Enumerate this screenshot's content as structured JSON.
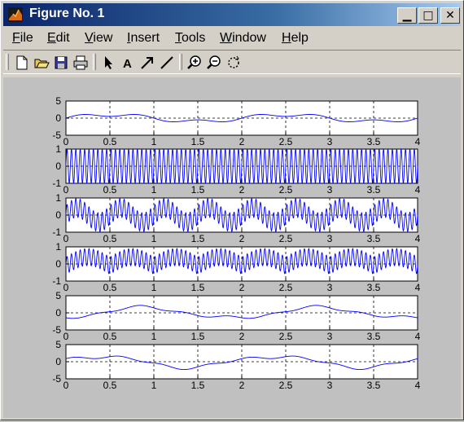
{
  "window": {
    "title": "Figure No. 1"
  },
  "menu": [
    {
      "key": "F",
      "rest": "ile"
    },
    {
      "key": "E",
      "rest": "dit"
    },
    {
      "key": "V",
      "rest": "iew"
    },
    {
      "key": "I",
      "rest": "nsert"
    },
    {
      "key": "T",
      "rest": "ools"
    },
    {
      "key": "W",
      "rest": "indow"
    },
    {
      "key": "H",
      "rest": "elp"
    }
  ],
  "toolbar_icons": [
    "new-file-icon",
    "open-folder-icon",
    "save-icon",
    "print-icon",
    "select-arrow-icon",
    "insert-text-icon",
    "insert-arrow-icon",
    "insert-line-icon",
    "zoom-in-icon",
    "zoom-out-icon",
    "rotate-icon"
  ],
  "colors": {
    "line": "#0000ff",
    "axes_bg": "#ffffff",
    "figure_bg": "#c0c0c0"
  },
  "chart_data": [
    {
      "type": "line",
      "xlim": [
        0,
        4
      ],
      "ylim": [
        -5,
        5
      ],
      "xticks": [
        "0",
        "0.5",
        "1",
        "1.5",
        "2",
        "2.5",
        "3",
        "3.5",
        "4"
      ],
      "yticks": [
        "5",
        "0",
        "-5"
      ],
      "grid": true,
      "series": [
        {
          "signal": "slow wave",
          "x_range": [
            0,
            4
          ]
        }
      ]
    },
    {
      "type": "line",
      "xlim": [
        0,
        4
      ],
      "ylim": [
        -1,
        1
      ],
      "xticks": [
        "0",
        "0.5",
        "1",
        "1.5",
        "2",
        "2.5",
        "3",
        "3.5",
        "4"
      ],
      "yticks": [
        "1",
        "0",
        "-1"
      ],
      "grid": true,
      "series": [
        {
          "signal": "fast oscillation",
          "x_range": [
            0,
            4
          ]
        }
      ]
    },
    {
      "type": "line",
      "xlim": [
        0,
        4
      ],
      "ylim": [
        -1,
        1
      ],
      "xticks": [
        "0",
        "0.5",
        "1",
        "1.5",
        "2",
        "2.5",
        "3",
        "3.5",
        "4"
      ],
      "yticks": [
        "1",
        "0",
        "-1"
      ],
      "grid": true,
      "series": [
        {
          "signal": "modulated oscillation",
          "x_range": [
            0,
            4
          ]
        }
      ]
    },
    {
      "type": "line",
      "xlim": [
        0,
        4
      ],
      "ylim": [
        -1,
        1
      ],
      "xticks": [
        "0",
        "0.5",
        "1",
        "1.5",
        "2",
        "2.5",
        "3",
        "3.5",
        "4"
      ],
      "yticks": [
        "1",
        "0",
        "-1"
      ],
      "grid": true,
      "series": [
        {
          "signal": "modulated oscillation",
          "x_range": [
            0,
            4
          ]
        }
      ]
    },
    {
      "type": "line",
      "xlim": [
        0,
        4
      ],
      "ylim": [
        -5,
        5
      ],
      "xticks": [
        "0",
        "0.5",
        "1",
        "1.5",
        "2",
        "2.5",
        "3",
        "3.5",
        "4"
      ],
      "yticks": [
        "5",
        "0",
        "-5"
      ],
      "grid": true,
      "series": [
        {
          "signal": "slow wave",
          "x_range": [
            0,
            4
          ]
        }
      ]
    },
    {
      "type": "line",
      "xlim": [
        0,
        4
      ],
      "ylim": [
        -5,
        5
      ],
      "xticks": [
        "0",
        "0.5",
        "1",
        "1.5",
        "2",
        "2.5",
        "3",
        "3.5",
        "4"
      ],
      "yticks": [
        "5",
        "0",
        "-5"
      ],
      "grid": true,
      "series": [
        {
          "signal": "slow wave",
          "x_range": [
            0,
            4
          ]
        }
      ]
    }
  ]
}
